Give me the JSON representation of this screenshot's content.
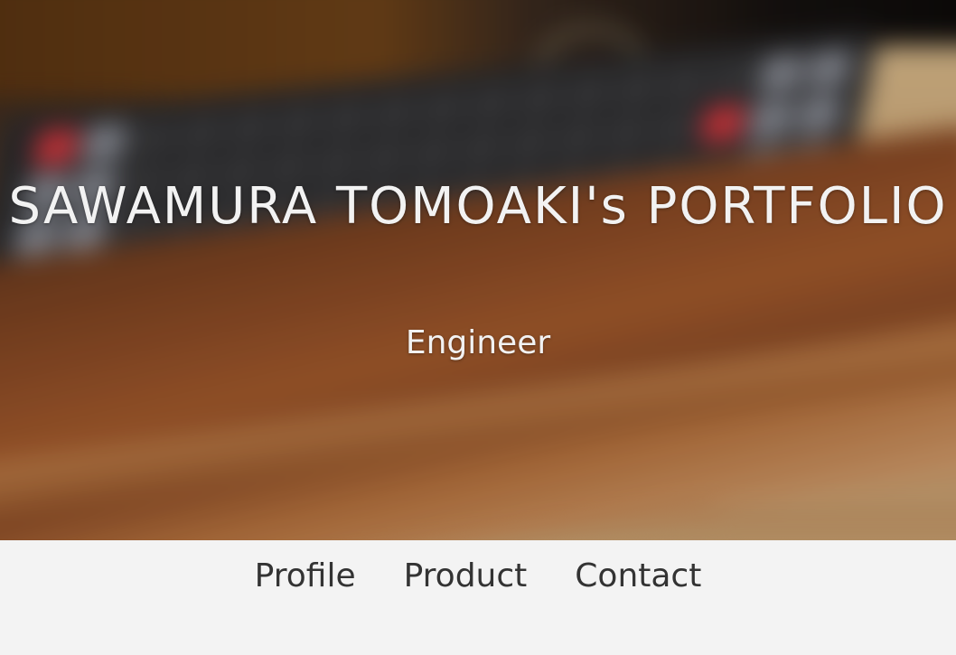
{
  "hero": {
    "title": "SAWAMURA TOMOAKI's PORTFOLIO",
    "subtitle": "Engineer",
    "background_image": "blurred-mechanical-keyboard-on-walnut-wrist-rest"
  },
  "nav": {
    "items": [
      {
        "label": "Profile"
      },
      {
        "label": "Product"
      },
      {
        "label": "Contact"
      }
    ]
  },
  "colors": {
    "hero_text": "#f2f2f2",
    "nav_text": "#333333",
    "nav_background": "#f3f3f3"
  }
}
